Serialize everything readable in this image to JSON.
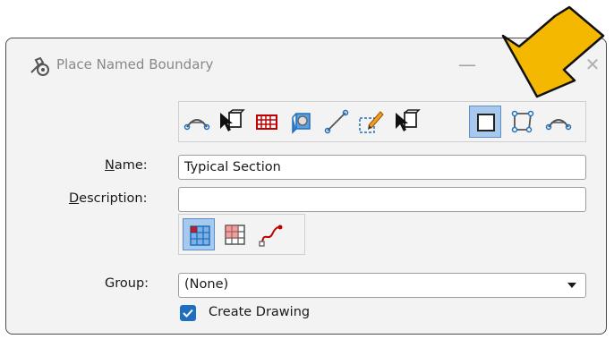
{
  "window": {
    "title": "Place Named Boundary",
    "minimize_glyph": "—",
    "close_glyph": "✕"
  },
  "toolbar": {
    "tools": [
      {
        "icon": "arc-boundary-icon"
      },
      {
        "icon": "select-view-icon"
      },
      {
        "icon": "grid-icon"
      },
      {
        "icon": "volume-icon"
      },
      {
        "icon": "line-icon"
      },
      {
        "icon": "edit-boundary-icon"
      },
      {
        "icon": "select-view-icon"
      },
      {
        "icon": "square-boundary-icon",
        "active": true
      },
      {
        "icon": "shape-boundary-icon"
      },
      {
        "icon": "arc-boundary-icon"
      }
    ]
  },
  "form": {
    "name_label": "Name:",
    "name_value": "Typical Section",
    "description_label": "Description:",
    "description_value": "",
    "group_label": "Group:",
    "group_value": "(None)",
    "create_drawing_label": "Create Drawing",
    "create_drawing_checked": true
  },
  "modes": [
    {
      "icon": "grid-mode-icon",
      "active": true
    },
    {
      "icon": "partial-grid-icon"
    },
    {
      "icon": "curve-path-icon"
    }
  ],
  "colors": {
    "accent": "#1f6fbf",
    "active_bg": "#a9c9ec",
    "annotation_arrow": "#f5b800"
  }
}
